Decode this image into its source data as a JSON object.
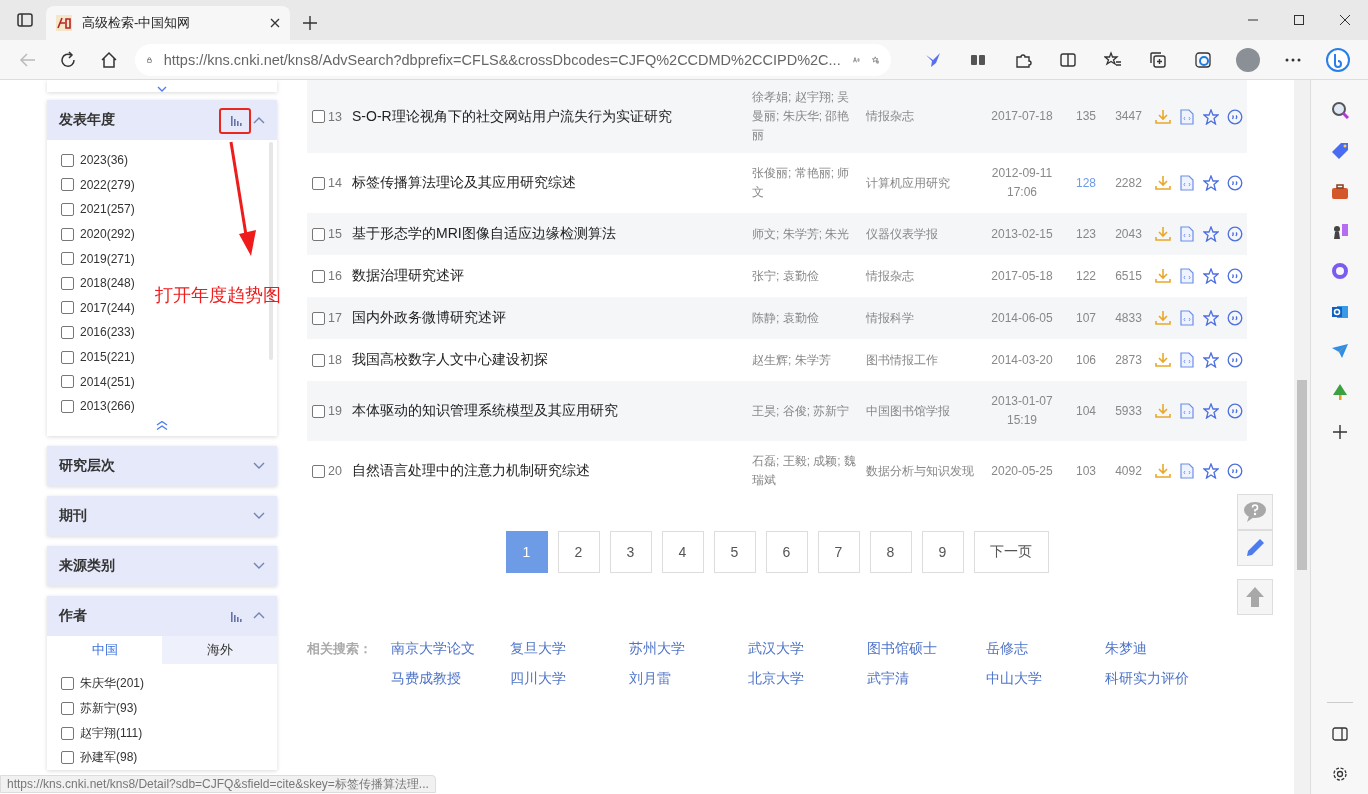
{
  "browser": {
    "tab_title": "高级检索-中国知网",
    "url": "https://kns.cnki.net/kns8/AdvSearch?dbprefix=CFLS&&crossDbcodes=CJFQ%2CCDMD%2CCIPD%2C..."
  },
  "sidebar": {
    "panels": [
      {
        "title": "发表年度",
        "expanded": true,
        "trend_icon": true,
        "items": [
          {
            "label": "2023(36)",
            "checked": false
          },
          {
            "label": "2022(279)",
            "checked": false
          },
          {
            "label": "2021(257)",
            "checked": false
          },
          {
            "label": "2020(292)",
            "checked": false
          },
          {
            "label": "2019(271)",
            "checked": false
          },
          {
            "label": "2018(248)",
            "checked": false
          },
          {
            "label": "2017(244)",
            "checked": false
          },
          {
            "label": "2016(233)",
            "checked": false
          },
          {
            "label": "2015(221)",
            "checked": false
          },
          {
            "label": "2014(251)",
            "checked": false
          },
          {
            "label": "2013(266)",
            "checked": false
          }
        ]
      },
      {
        "title": "研究层次",
        "expanded": false,
        "trend_icon": false
      },
      {
        "title": "期刊",
        "expanded": false,
        "trend_icon": false
      },
      {
        "title": "来源类别",
        "expanded": false,
        "trend_icon": false
      },
      {
        "title": "作者",
        "expanded": true,
        "trend_icon": true,
        "tabs": [
          {
            "label": "中国",
            "selected": true
          },
          {
            "label": "海外",
            "selected": false
          }
        ],
        "items": [
          {
            "label": "朱庆华(201)",
            "checked": false
          },
          {
            "label": "苏新宁(93)",
            "checked": false
          },
          {
            "label": "赵宇翔(111)",
            "checked": false
          },
          {
            "label": "孙建军(98)",
            "checked": false
          }
        ]
      }
    ]
  },
  "annotation": {
    "text": "打开年度趋势图"
  },
  "results": [
    {
      "number": "13",
      "title": "S-O-R理论视角下的社交网站用户流失行为实证研究",
      "authors": "徐孝娟; 赵宇翔; 吴曼丽; 朱庆华; 邵艳丽",
      "source": "情报杂志",
      "date": "2017-07-18",
      "cited": "135",
      "downloads": "3447",
      "checked": false,
      "cited_highlighted": false
    },
    {
      "number": "14",
      "title": "标签传播算法理论及其应用研究综述",
      "authors": "张俊丽; 常艳丽; 师文",
      "source": "计算机应用研究",
      "date": "2012-09-11 17:06",
      "cited": "128",
      "downloads": "2282",
      "checked": false,
      "cited_highlighted": true
    },
    {
      "number": "15",
      "title": "基于形态学的MRI图像自适应边缘检测算法",
      "authors": "师文; 朱学芳; 朱光",
      "source": "仪器仪表学报",
      "date": "2013-02-15",
      "cited": "123",
      "downloads": "2043",
      "checked": false,
      "cited_highlighted": false
    },
    {
      "number": "16",
      "title": "数据治理研究述评",
      "authors": "张宁; 袁勤俭",
      "source": "情报杂志",
      "date": "2017-05-18",
      "cited": "122",
      "downloads": "6515",
      "checked": false,
      "cited_highlighted": false
    },
    {
      "number": "17",
      "title": "国内外政务微博研究述评",
      "authors": "陈静; 袁勤俭",
      "source": "情报科学",
      "date": "2014-06-05",
      "cited": "107",
      "downloads": "4833",
      "checked": false,
      "cited_highlighted": false
    },
    {
      "number": "18",
      "title": "我国高校数字人文中心建设初探",
      "authors": "赵生辉; 朱学芳",
      "source": "图书情报工作",
      "date": "2014-03-20",
      "cited": "106",
      "downloads": "2873",
      "checked": false,
      "cited_highlighted": false
    },
    {
      "number": "19",
      "title": "本体驱动的知识管理系统模型及其应用研究",
      "authors": "王昊; 谷俊; 苏新宁",
      "source": "中国图书馆学报",
      "date": "2013-01-07 15:19",
      "cited": "104",
      "downloads": "5933",
      "checked": false,
      "cited_highlighted": false
    },
    {
      "number": "20",
      "title": "自然语言处理中的注意力机制研究综述",
      "authors": "石磊; 王毅; 成颖; 魏瑞斌",
      "source": "数据分析与知识发现",
      "date": "2020-05-25",
      "cited": "103",
      "downloads": "4092",
      "checked": false,
      "cited_highlighted": false
    }
  ],
  "pagination": {
    "pages": [
      {
        "label": "1",
        "selected": true
      },
      {
        "label": "2",
        "selected": false
      },
      {
        "label": "3",
        "selected": false
      },
      {
        "label": "4",
        "selected": false
      },
      {
        "label": "5",
        "selected": false
      },
      {
        "label": "6",
        "selected": false
      },
      {
        "label": "7",
        "selected": false
      },
      {
        "label": "8",
        "selected": false
      },
      {
        "label": "9",
        "selected": false
      }
    ],
    "next": "下一页"
  },
  "related_searches": {
    "label": "相关搜索：",
    "links": [
      "南京大学论文",
      "复旦大学",
      "苏州大学",
      "武汉大学",
      "图书馆硕士",
      "岳修志",
      "朱梦迪",
      "马费成教授",
      "四川大学",
      "刘月雷",
      "北京大学",
      "武宇清",
      "中山大学",
      "科研实力评价"
    ]
  },
  "status_bar": {
    "url": "https://kns.cnki.net/kns8/Detail?sdb=CJFQ&sfield=cite&skey=标签传播算法理..."
  }
}
